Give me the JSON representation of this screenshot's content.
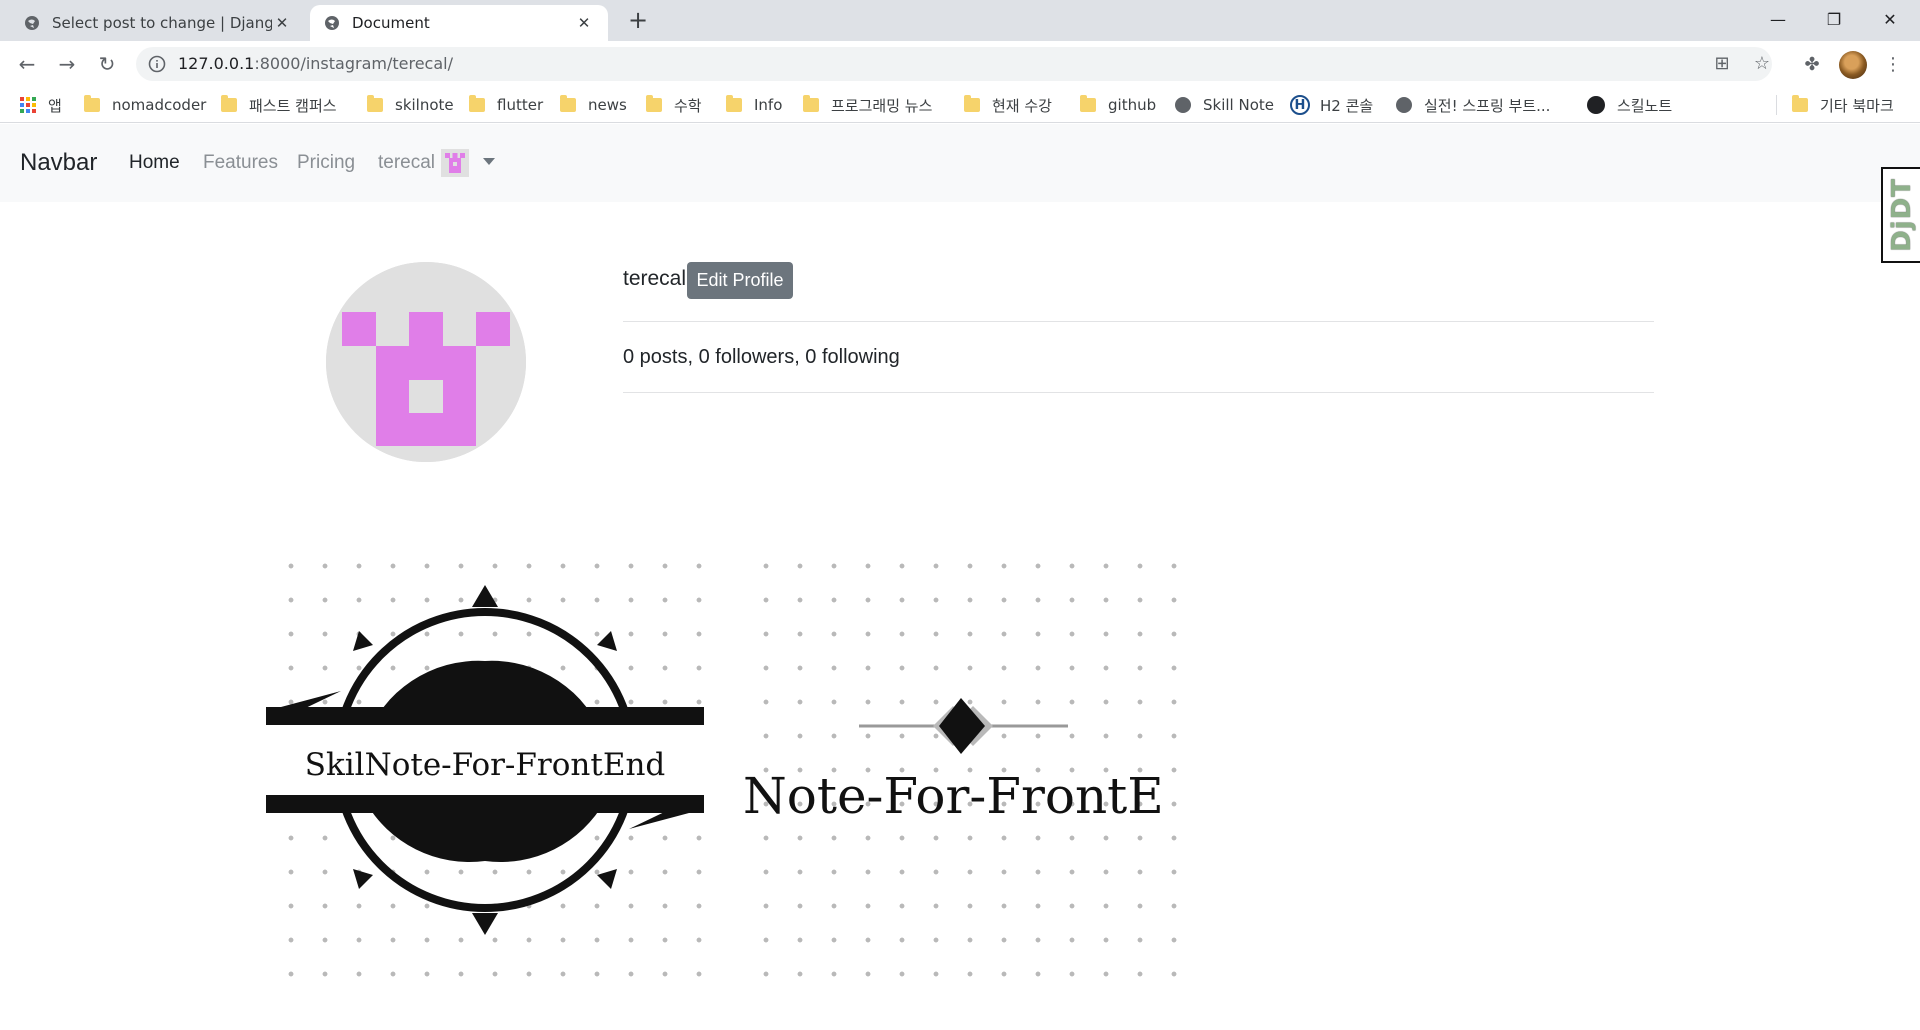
{
  "browser": {
    "tabs": [
      {
        "title": "Select post to change | Django",
        "active": false
      },
      {
        "title": "Document",
        "active": true
      }
    ],
    "new_tab": "+",
    "url_host": "127.0.0.1",
    "url_rest": ":8000/instagram/terecal/",
    "bookmarks": [
      {
        "label": "앱",
        "icon": "apps-icon"
      },
      {
        "label": "nomadcoder",
        "icon": "folder-icon"
      },
      {
        "label": "패스트 캠퍼스",
        "icon": "folder-icon"
      },
      {
        "label": "skilnote",
        "icon": "folder-icon"
      },
      {
        "label": "flutter",
        "icon": "folder-icon"
      },
      {
        "label": "news",
        "icon": "folder-icon"
      },
      {
        "label": "수학",
        "icon": "folder-icon"
      },
      {
        "label": "Info",
        "icon": "folder-icon"
      },
      {
        "label": "프로그래밍 뉴스",
        "icon": "folder-icon"
      },
      {
        "label": "현재 수강",
        "icon": "folder-icon"
      },
      {
        "label": "github",
        "icon": "folder-icon"
      },
      {
        "label": "Skill Note",
        "icon": "globe-icon"
      },
      {
        "label": "H2 콘솔",
        "icon": "h2-icon"
      },
      {
        "label": "실전! 스프링 부트...",
        "icon": "globe-icon"
      },
      {
        "label": "스킬노트",
        "icon": "github-icon"
      },
      {
        "label": "기타 북마크",
        "icon": "folder-icon"
      }
    ]
  },
  "navbar": {
    "brand": "Navbar",
    "links": [
      {
        "label": "Home",
        "active": true
      },
      {
        "label": "Features",
        "active": false
      },
      {
        "label": "Pricing",
        "active": false
      }
    ],
    "user": "terecal"
  },
  "djdt": {
    "label": "DjDT"
  },
  "profile": {
    "username": "terecal",
    "edit_label": "Edit Profile",
    "stats": "0 posts, 0 followers, 0 following",
    "avatar_color": "#e07ee8"
  },
  "posts": [
    {
      "caption": "SkilNote-For-FrontEnd"
    },
    {
      "caption": "Note-For-FrontE"
    }
  ],
  "colors": {
    "navbar_bg": "#f8f9fa",
    "button_secondary": "#6c757d",
    "identicon": "#e07ee8"
  }
}
